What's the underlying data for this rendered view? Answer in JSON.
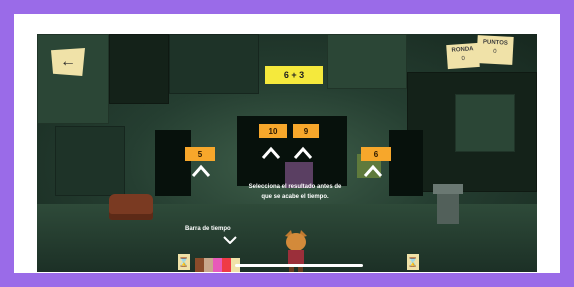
{
  "game": {
    "back_icon": "arrow-left-icon",
    "question": "6 + 3",
    "answers": [
      {
        "label": "5"
      },
      {
        "label": "10"
      },
      {
        "label": "9"
      },
      {
        "label": "6"
      }
    ],
    "instruction_line1": "Selecciona el resultado antes de",
    "instruction_line2": "que se acabe el tiempo.",
    "timer_label": "Barra de tiempo",
    "score": {
      "ronda_label": "RONDA",
      "ronda_value": "0",
      "puntos_label": "PUNTOS",
      "puntos_value": "0"
    },
    "timer_colors": [
      "#8a4b2a",
      "#c9a88c",
      "#e85ab9",
      "#ef3b46",
      "#f0e2a8"
    ],
    "colors": {
      "frame_bg": "#9a6be8",
      "question_bg": "#f5e93c",
      "answer_bg": "#f7a72b",
      "card_bg": "#f0e2a8"
    }
  }
}
